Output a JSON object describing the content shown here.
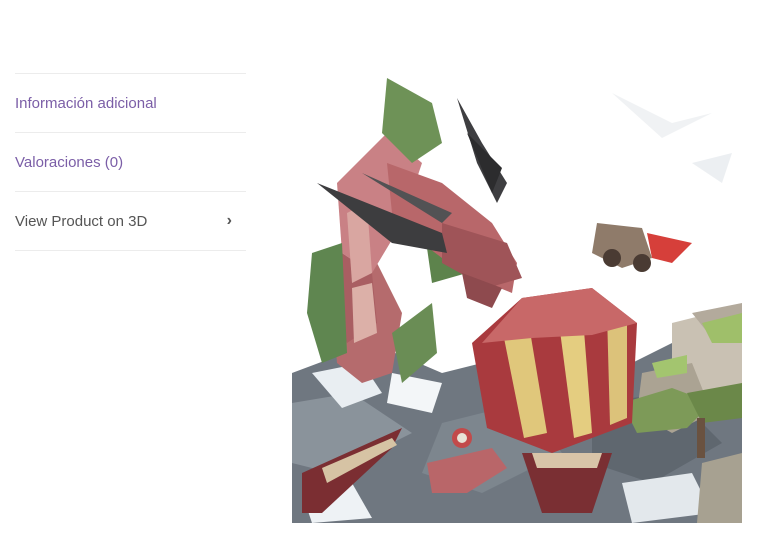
{
  "tabs": [
    {
      "label": "Información adicional"
    },
    {
      "label": "Valoraciones (0)"
    },
    {
      "label": "View Product on 3D"
    }
  ],
  "product_image": {
    "subject": "low-poly viking ship attacked by a red sea dragon"
  },
  "colors": {
    "link": "#7b5ea7",
    "text": "#555555",
    "divider": "#ececec"
  }
}
